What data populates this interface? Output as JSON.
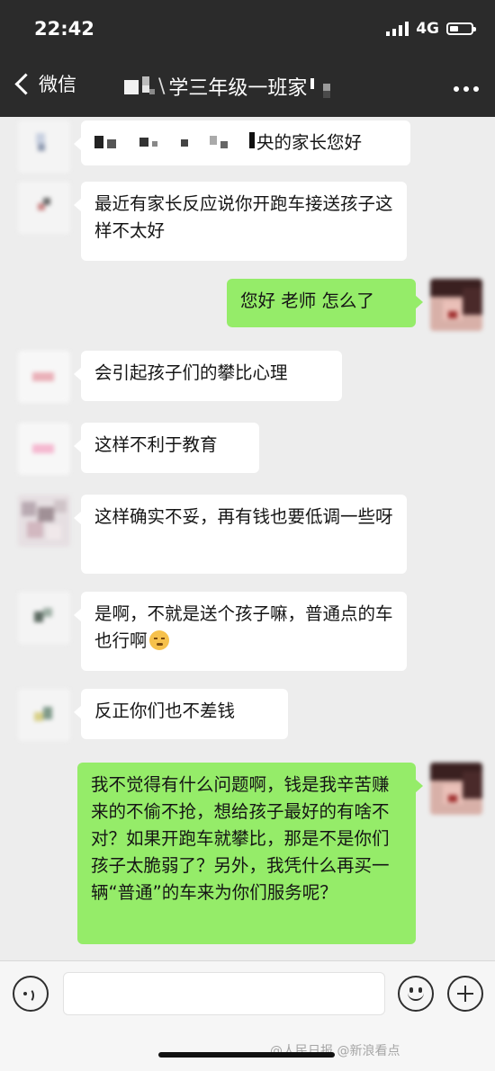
{
  "status_bar": {
    "time": "22:42",
    "network": "4G"
  },
  "nav": {
    "back_label": "微信",
    "title": "学三年级一班家",
    "more_icon": "more-dots-icon"
  },
  "messages": [
    {
      "text": "央的家长您好",
      "side": "left"
    },
    {
      "text": "最近有家长反应说你开跑车接送孩子这样不太好",
      "side": "left"
    },
    {
      "text": "您好 老师 怎么了",
      "side": "right"
    },
    {
      "text": "会引起孩子们的攀比心理",
      "side": "left"
    },
    {
      "text": "这样不利于教育",
      "side": "left"
    },
    {
      "text": "这样确实不妥，再有钱也要低调一些呀",
      "side": "left"
    },
    {
      "text": "是啊，不就是送个孩子嘛，普通点的车也行啊",
      "side": "left",
      "emoji": "face-emoji-icon"
    },
    {
      "text": "反正你们也不差钱",
      "side": "left"
    },
    {
      "text": "我不觉得有什么问题啊，钱是我辛苦赚来的不偷不抢，想给孩子最好的有啥不对？如果开跑车就攀比，那是不是你们孩子太脆弱了？另外，我凭什么再买一辆“普通”的车来为你们服务呢？",
      "side": "right"
    }
  ],
  "input_bar": {
    "voice_icon": "voice-icon",
    "emoji_icon": "emoji-icon",
    "plus_icon": "plus-icon"
  },
  "watermark": "@人民日报 @新浪看点"
}
